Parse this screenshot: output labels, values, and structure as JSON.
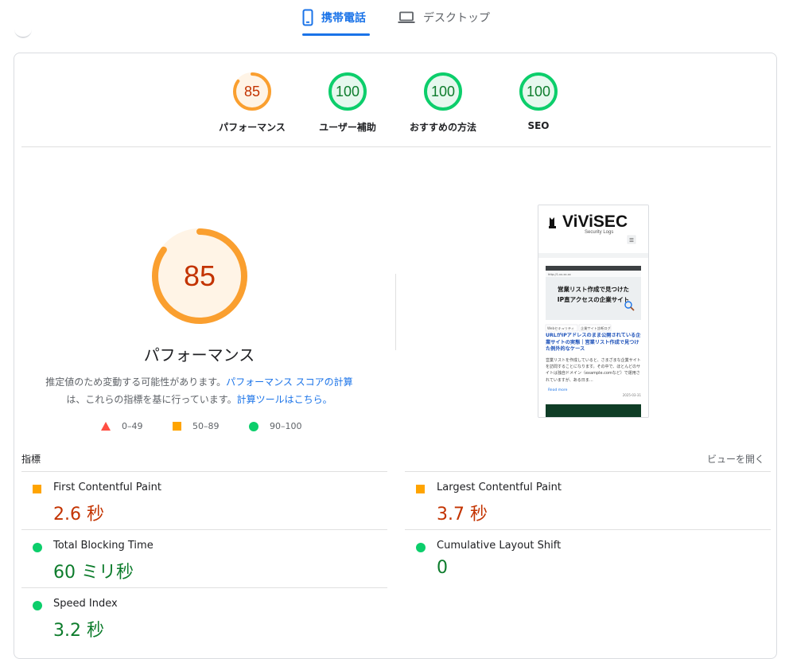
{
  "tabs": [
    {
      "label": "携帯電話",
      "icon": "smartphone-icon",
      "active": true
    },
    {
      "label": "デスクトップ",
      "icon": "laptop-icon",
      "active": false
    }
  ],
  "categories": [
    {
      "score": "85",
      "label": "パフォーマンス",
      "color": "#fa9f2f",
      "fill": "#fff4e6",
      "text": "#c33300",
      "fraction": 0.85
    },
    {
      "score": "100",
      "label": "ユーザー補助",
      "color": "#0cce6b",
      "fill": "#e6f8ee",
      "text": "#0d7c2c",
      "fraction": 1.0
    },
    {
      "score": "100",
      "label": "おすすめの方法",
      "color": "#0cce6b",
      "fill": "#e6f8ee",
      "text": "#0d7c2c",
      "fraction": 1.0
    },
    {
      "score": "100",
      "label": "SEO",
      "color": "#0cce6b",
      "fill": "#e6f8ee",
      "text": "#0d7c2c",
      "fraction": 1.0
    }
  ],
  "performance": {
    "score": "85",
    "fraction": 0.85,
    "title": "パフォーマンス",
    "desc_1": "推定値のため変動する可能性があります。",
    "desc_link_1": "パフォーマンス スコアの計算",
    "desc_2": "は、これらの指標を基に行っています。",
    "desc_link_2": "計算ツールはこちら。"
  },
  "legend": [
    {
      "label": "0–49",
      "shape": "triangle",
      "color": "#ff4e42"
    },
    {
      "label": "50–89",
      "shape": "square",
      "color": "#ffa400"
    },
    {
      "label": "90–100",
      "shape": "circle",
      "color": "#0cce6b"
    }
  ],
  "screenshot": {
    "brand": "ViViSEC",
    "tagline": "Security Logs",
    "url": "http://1.xx.xx.xx",
    "hero_line_1": "営業リスト作成で見つけた",
    "hero_line_2": "IP直アクセスの企業サイト",
    "tag_1": "Webセキュリティ",
    "tag_2": "企業サイト診断ログ",
    "post_title": "URLがIPアドレスのまま公開されている企業サイトの実態｜営業リスト作成で見つけた例外的なケース",
    "excerpt": "営業リストを作成していると、さまざまな企業サイトを訪問することになります。その中で、ほとんどのサイトは独自ドメイン（example.comなど）で運用されていますが、ある日ま…",
    "read_more": "Read more",
    "date": "2025-03-31"
  },
  "metrics_header": {
    "title": "指標",
    "toggle": "ビューを開く"
  },
  "metrics": [
    {
      "name": "First Contentful Paint",
      "value": "2.6 秒",
      "status": "average"
    },
    {
      "name": "Largest Contentful Paint",
      "value": "3.7 秒",
      "status": "average"
    },
    {
      "name": "Total Blocking Time",
      "value": "60 ミリ秒",
      "status": "pass"
    },
    {
      "name": "Cumulative Layout Shift",
      "value": "0",
      "status": "pass"
    },
    {
      "name": "Speed Index",
      "value": "3.2 秒",
      "status": "pass"
    }
  ]
}
